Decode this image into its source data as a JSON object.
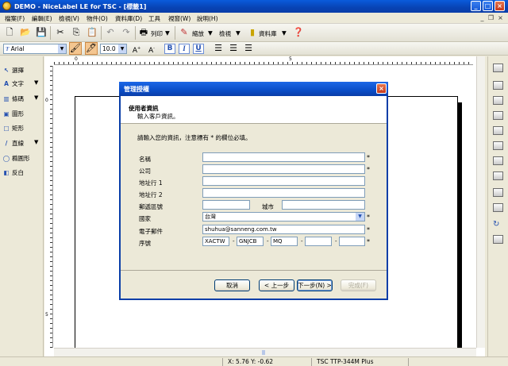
{
  "window": {
    "title": "DEMO - NiceLabel LE for TSC - [標籤1]",
    "controls": [
      "_",
      "□",
      "×"
    ]
  },
  "menu": [
    "檔案(F)",
    "編輯(E)",
    "檢視(V)",
    "物件(O)",
    "資料庫(D)",
    "工具",
    "視窗(W)",
    "說明(H)"
  ],
  "toolbar1": {
    "print_label": "列印",
    "zoom_label": "縮放",
    "view_label": "檢視",
    "database_label": "資料庫"
  },
  "toolbar2": {
    "font_name": "Arial",
    "font_size": "10.0",
    "bold": "B",
    "italic": "I",
    "underline": "U"
  },
  "left_tools": [
    {
      "label": "選擇",
      "icon": "↖"
    },
    {
      "label": "文字",
      "icon": "A"
    },
    {
      "label": "條碼",
      "icon": "▥"
    },
    {
      "label": "圖形",
      "icon": "▣"
    },
    {
      "label": "矩形",
      "icon": "□"
    },
    {
      "label": "直線",
      "icon": "/"
    },
    {
      "label": "橢圓形",
      "icon": "◯"
    },
    {
      "label": "反白",
      "icon": "◧"
    }
  ],
  "ruler": {
    "h": [
      "0",
      "5"
    ],
    "v": [
      "0",
      "5"
    ]
  },
  "statusbar": {
    "coords": "X: 5.76 Y: -0.62",
    "printer": "TSC TTP-344M Plus"
  },
  "dialog": {
    "title": "管理授權",
    "header_title": "使用者資訊",
    "header_subtitle": "輸入客戶資訊。",
    "intro": "請輸入您的資訊，注意標有 * 的欄位必填。",
    "labels": {
      "name": "名稱",
      "company": "公司",
      "address1": "地址行 1",
      "address2": "地址行 2",
      "postal": "郵遞區號",
      "city": "城市",
      "country": "國家",
      "email": "電子郵件",
      "serial": "序號"
    },
    "values": {
      "country": "台灣",
      "email": "shuhua@sanneng.com.tw",
      "serial": [
        "XACTW",
        "GNJCB",
        "MQ",
        "",
        ""
      ]
    },
    "required_mark": "*",
    "separator": "-",
    "buttons": {
      "cancel": "取消",
      "back": "< 上一步",
      "next": "下一步(N) >",
      "finish": "完成(F)"
    }
  }
}
